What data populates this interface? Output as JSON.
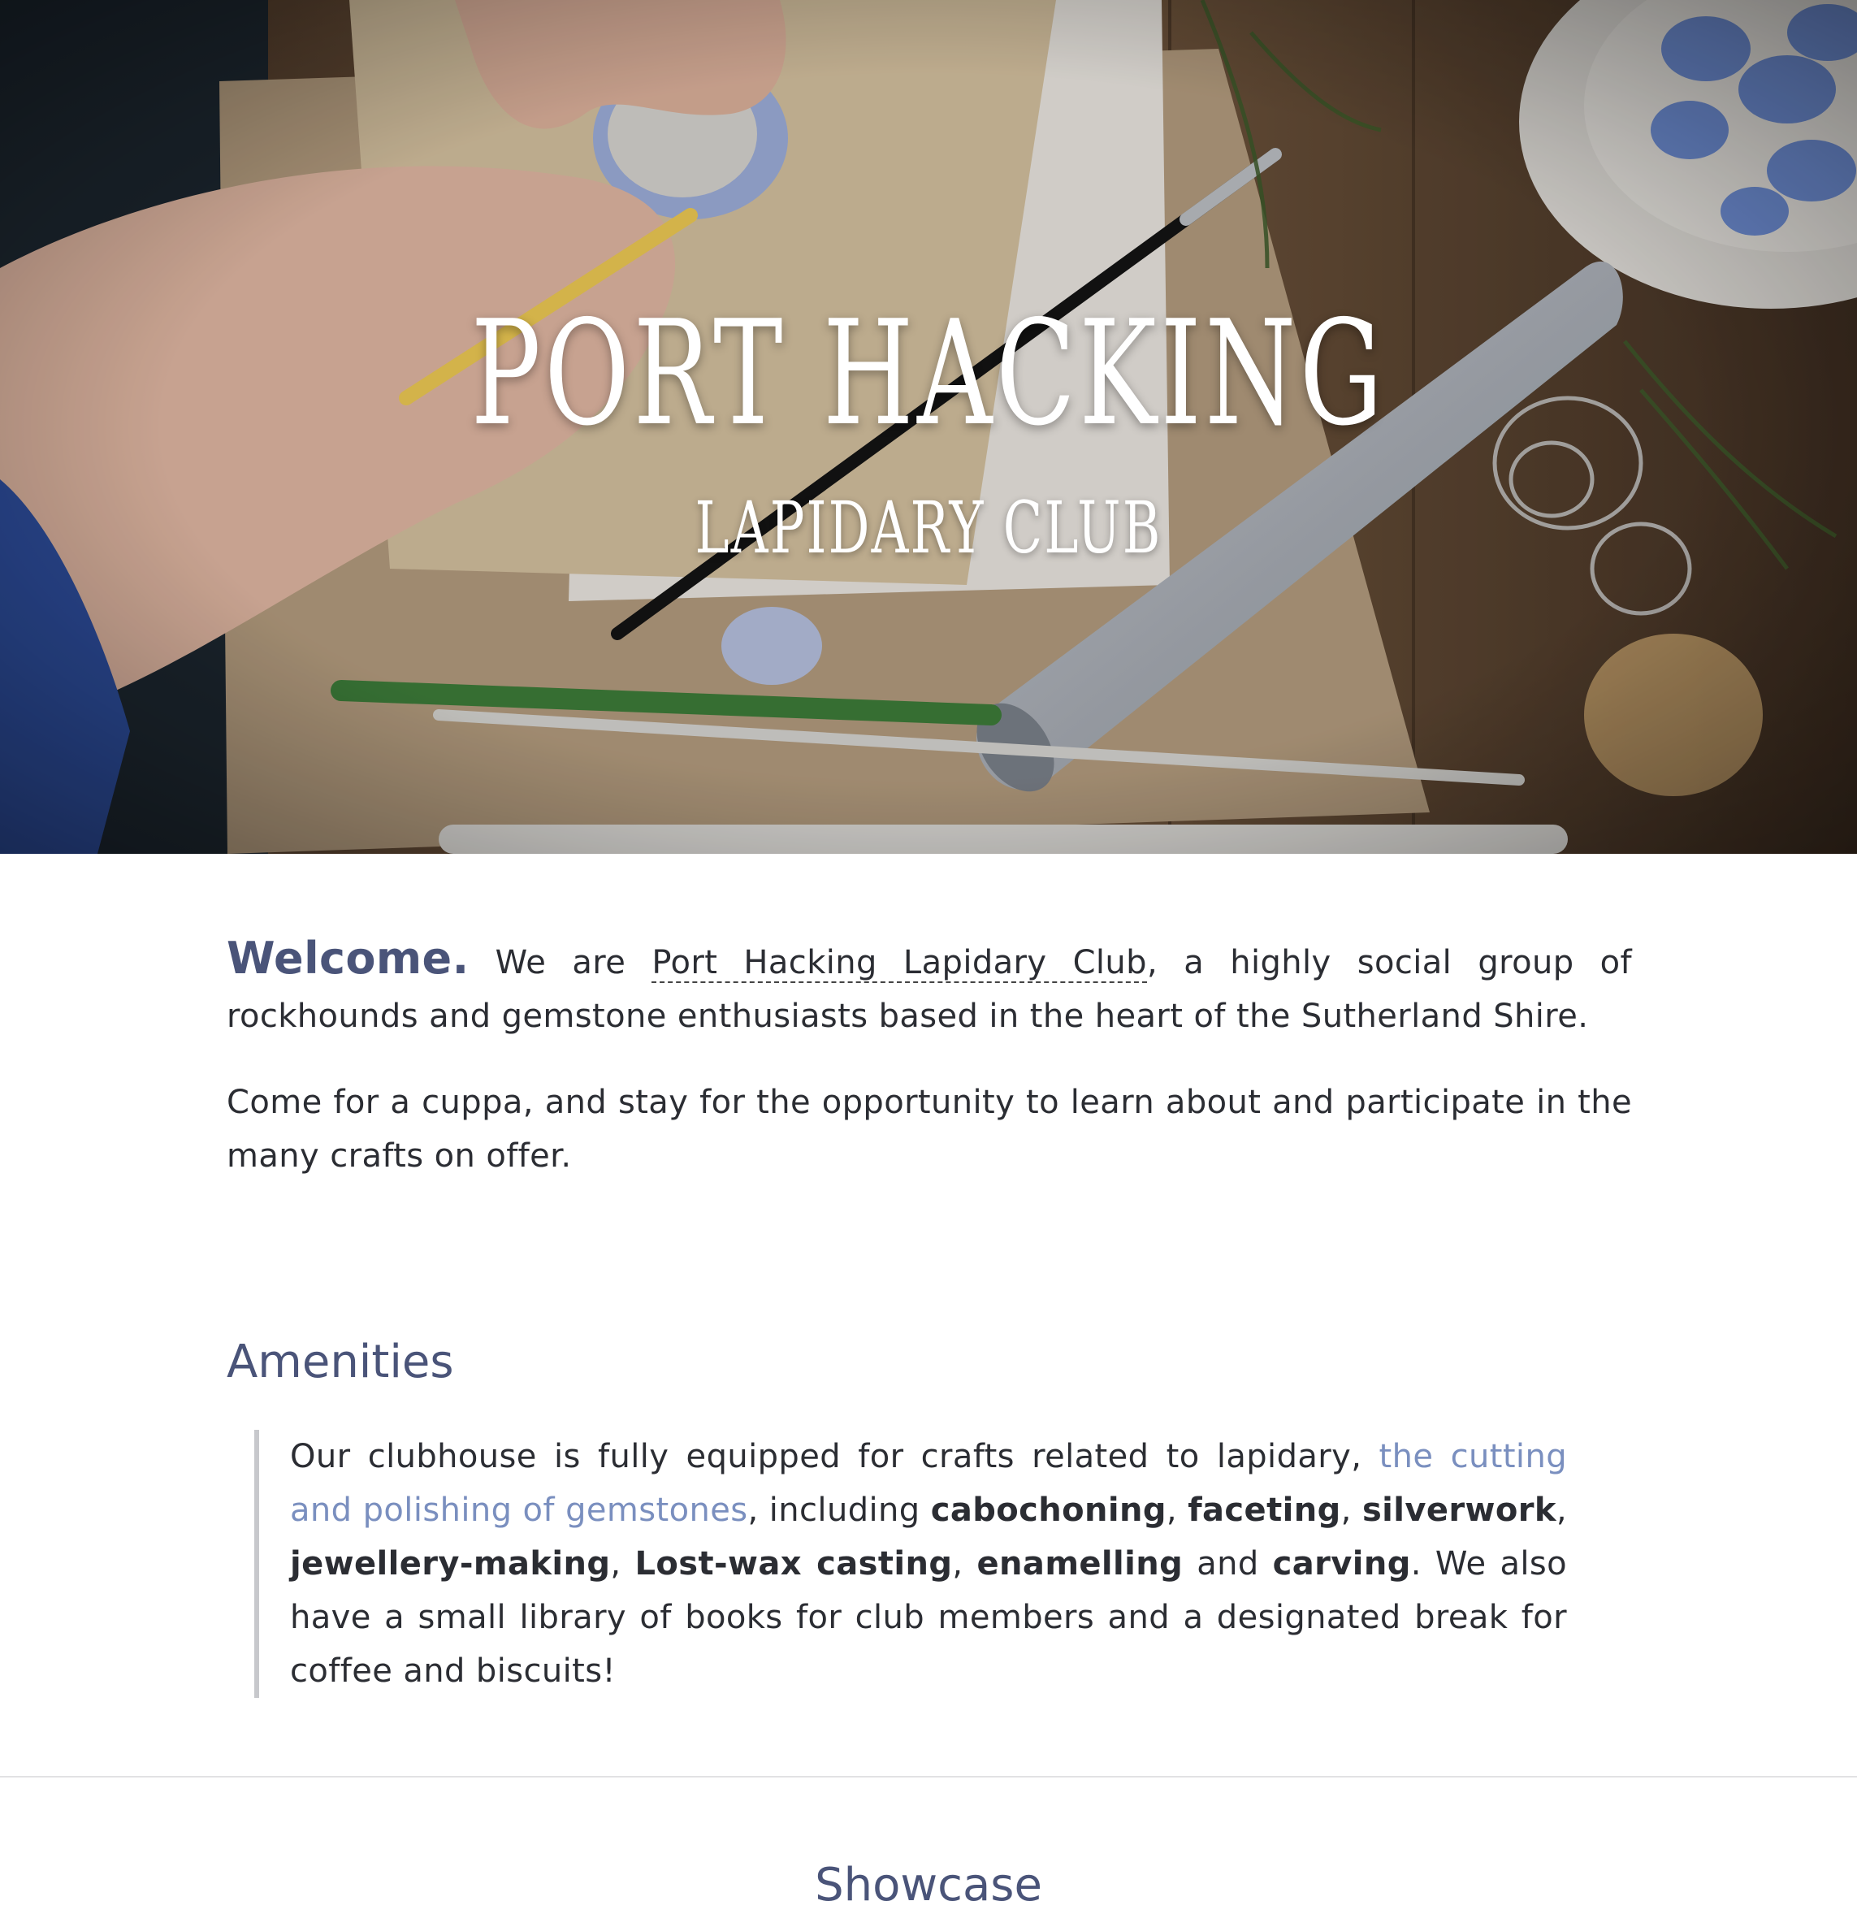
{
  "hero": {
    "title": "PORT HACKING",
    "subtitle": "LAPIDARY CLUB"
  },
  "welcome": {
    "lead": "Welcome.",
    "before_link": "We are",
    "club_link": "Port Hacking Lapidary Club",
    "after_link": ", a highly social group of rockhounds and gemstone enthusiasts based in the heart of the Sutherland Shire."
  },
  "intro2": "Come for a cuppa, and stay for the opportunity to learn about and participate in the many crafts on offer.",
  "amenities": {
    "heading": "Amenities",
    "t1": "Our clubhouse is fully equipped for crafts related to lapidary,",
    "link": "the cutting and polishing of gemstones",
    "t2": ", including",
    "craft1": "cabochoning",
    "sep1": ",",
    "craft2": "faceting",
    "sep2": ",",
    "craft3": "silverwork",
    "sep3": ",",
    "craft4": "jewellery-making",
    "sep4": ",",
    "craft5": "Lost-wax casting",
    "sep5": ",",
    "craft6": "enamelling",
    "and": "and",
    "craft7": "carving",
    "t3": ". We also have a small library of books for club members and a designated break for coffee and biscuits!"
  },
  "showcase": {
    "heading": "Showcase"
  },
  "colors": {
    "heading": "#4a5479",
    "link": "#7a8fbf",
    "text": "#2b2d33",
    "rule": "#c7c8cc"
  }
}
